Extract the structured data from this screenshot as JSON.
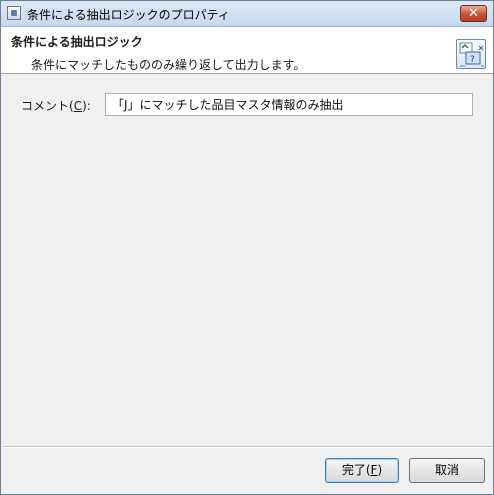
{
  "window": {
    "title": "条件による抽出ロジックのプロパティ",
    "close_label": "✕"
  },
  "header": {
    "title": "条件による抽出ロジック",
    "description": "条件にマッチしたもののみ繰り返して出力します。"
  },
  "form": {
    "comment_label_prefix": "コメント(",
    "comment_label_mnemonic": "C",
    "comment_label_suffix": "):",
    "comment_value": "「J」にマッチした品目マスタ情報のみ抽出"
  },
  "buttons": {
    "finish_prefix": "完了(",
    "finish_mnemonic": "F",
    "finish_suffix": ")",
    "cancel": "取消"
  }
}
